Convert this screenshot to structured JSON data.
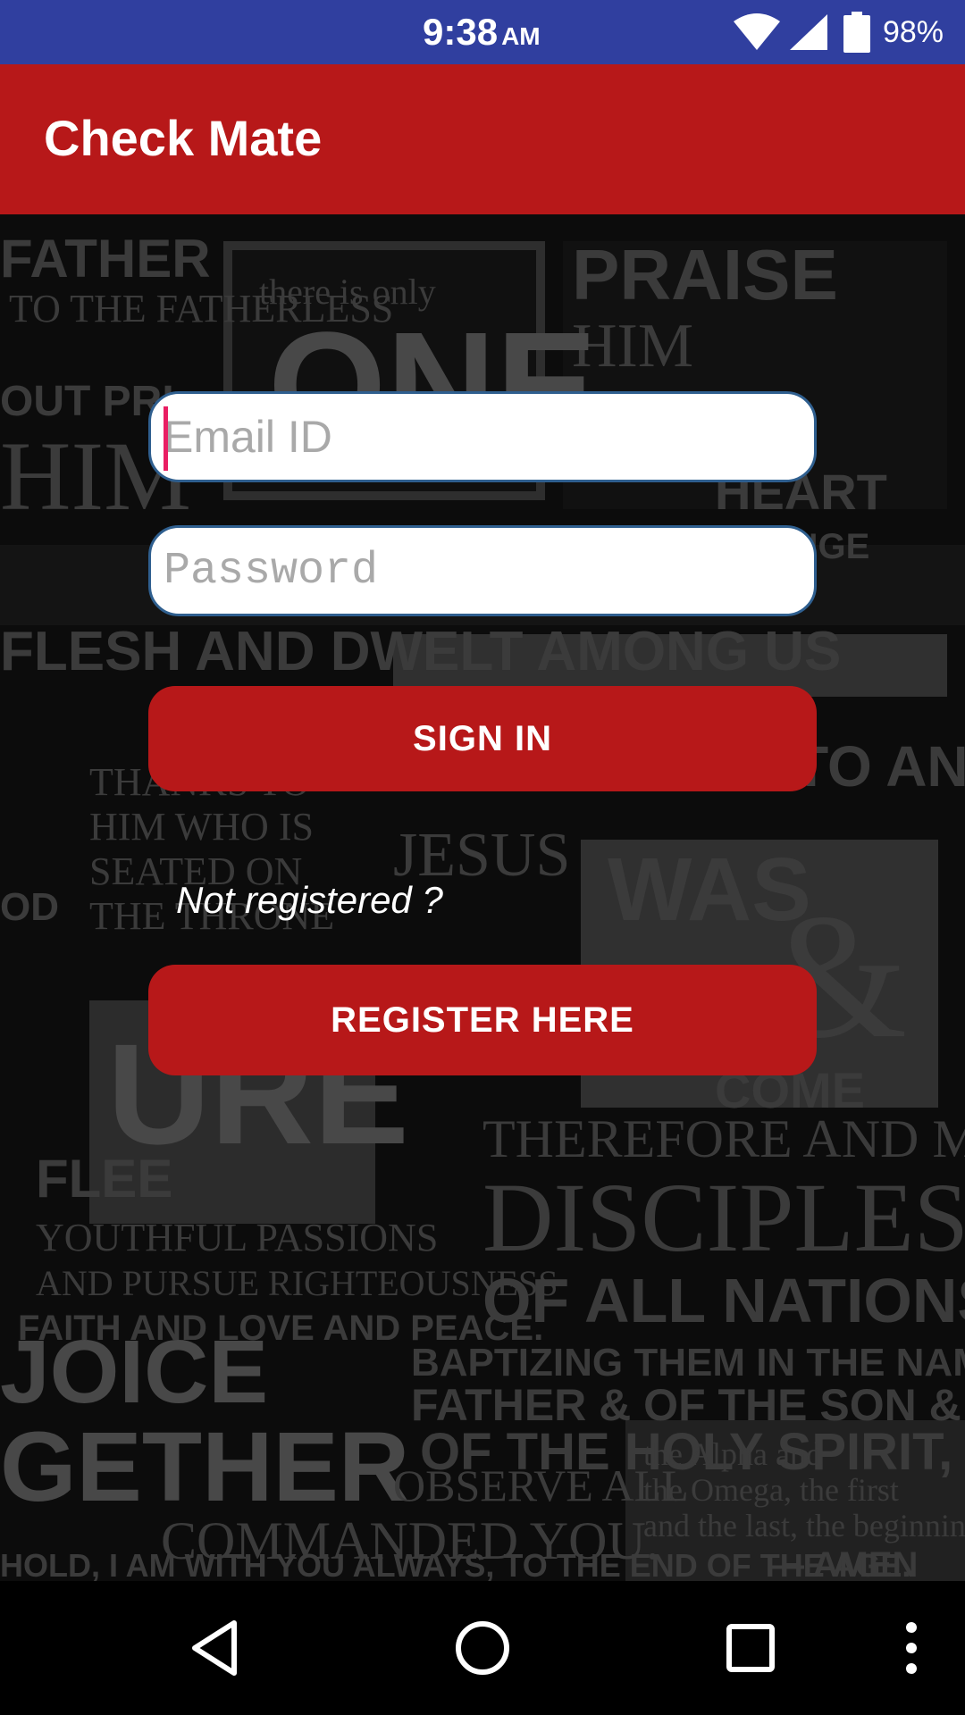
{
  "status_bar": {
    "time": "9:38",
    "ampm": "AM",
    "battery": "98%",
    "icons": [
      "wifi-icon",
      "signal-icon",
      "battery-icon"
    ]
  },
  "app_bar": {
    "title": "Check Mate",
    "color": "#B71819"
  },
  "form": {
    "email_placeholder": "Email ID",
    "password_placeholder": "Password",
    "signin_label": "SIGN IN",
    "not_registered": "Not registered ?",
    "register_label": "REGISTER HERE"
  },
  "nav_bar": {
    "icons": [
      "back-icon",
      "home-icon",
      "recents-icon",
      "more-icon"
    ]
  },
  "colors": {
    "status_bar": "#303F9F",
    "accent": "#B71819",
    "cursor": "#E91E63"
  }
}
